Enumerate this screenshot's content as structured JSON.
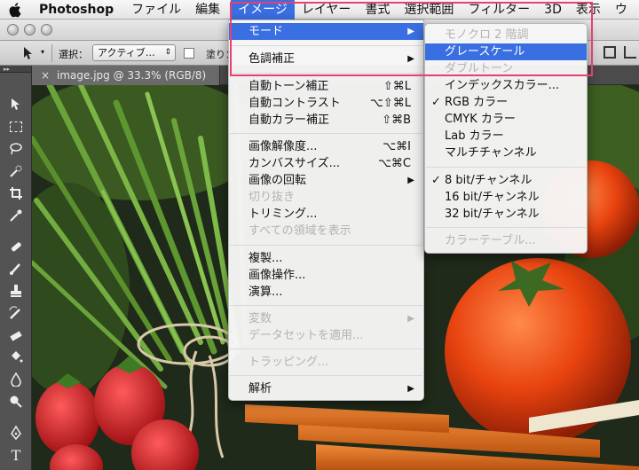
{
  "menubar": {
    "app": "Photoshop",
    "items": [
      "ファイル",
      "編集",
      "イメージ",
      "レイヤー",
      "書式",
      "選択範囲",
      "フィルター",
      "3D",
      "表示",
      "ウ"
    ]
  },
  "options": {
    "select_label": "選択：",
    "select_value": "アクティブ…",
    "fill_label": "塗り："
  },
  "document": {
    "tab_title": "image.jpg @ 33.3% (RGB/8)"
  },
  "image_menu": {
    "mode": "モード",
    "adjustments": "色調補正",
    "auto_tone": "自動トーン補正",
    "auto_tone_sc": "⇧⌘L",
    "auto_contrast": "自動コントラスト",
    "auto_contrast_sc": "⌥⇧⌘L",
    "auto_color": "自動カラー補正",
    "auto_color_sc": "⇧⌘B",
    "image_size": "画像解像度...",
    "image_size_sc": "⌥⌘I",
    "canvas_size": "カンバスサイズ...",
    "canvas_size_sc": "⌥⌘C",
    "rotation": "画像の回転",
    "crop": "切り抜き",
    "trim": "トリミング...",
    "reveal_all": "すべての領域を表示",
    "duplicate": "複製...",
    "apply_image": "画像操作...",
    "calculations": "演算...",
    "variables": "変数",
    "apply_dataset": "データセットを適用...",
    "trap": "トラッピング...",
    "analysis": "解析"
  },
  "mode_menu": {
    "bitmap": "モノクロ 2 階調",
    "grayscale": "グレースケール",
    "duotone": "ダブルトーン",
    "indexed": "インデックスカラー...",
    "rgb": "RGB カラー",
    "cmyk": "CMYK カラー",
    "lab": "Lab カラー",
    "multichannel": "マルチチャンネル",
    "bit8": "8 bit/チャンネル",
    "bit16": "16 bit/チャンネル",
    "bit32": "32 bit/チャンネル",
    "color_table": "カラーテーブル..."
  },
  "glyphs": {
    "check": "✓",
    "arrow": "▶"
  },
  "colors": {
    "highlight": "#3a6fe2",
    "callout": "#e4416f"
  }
}
